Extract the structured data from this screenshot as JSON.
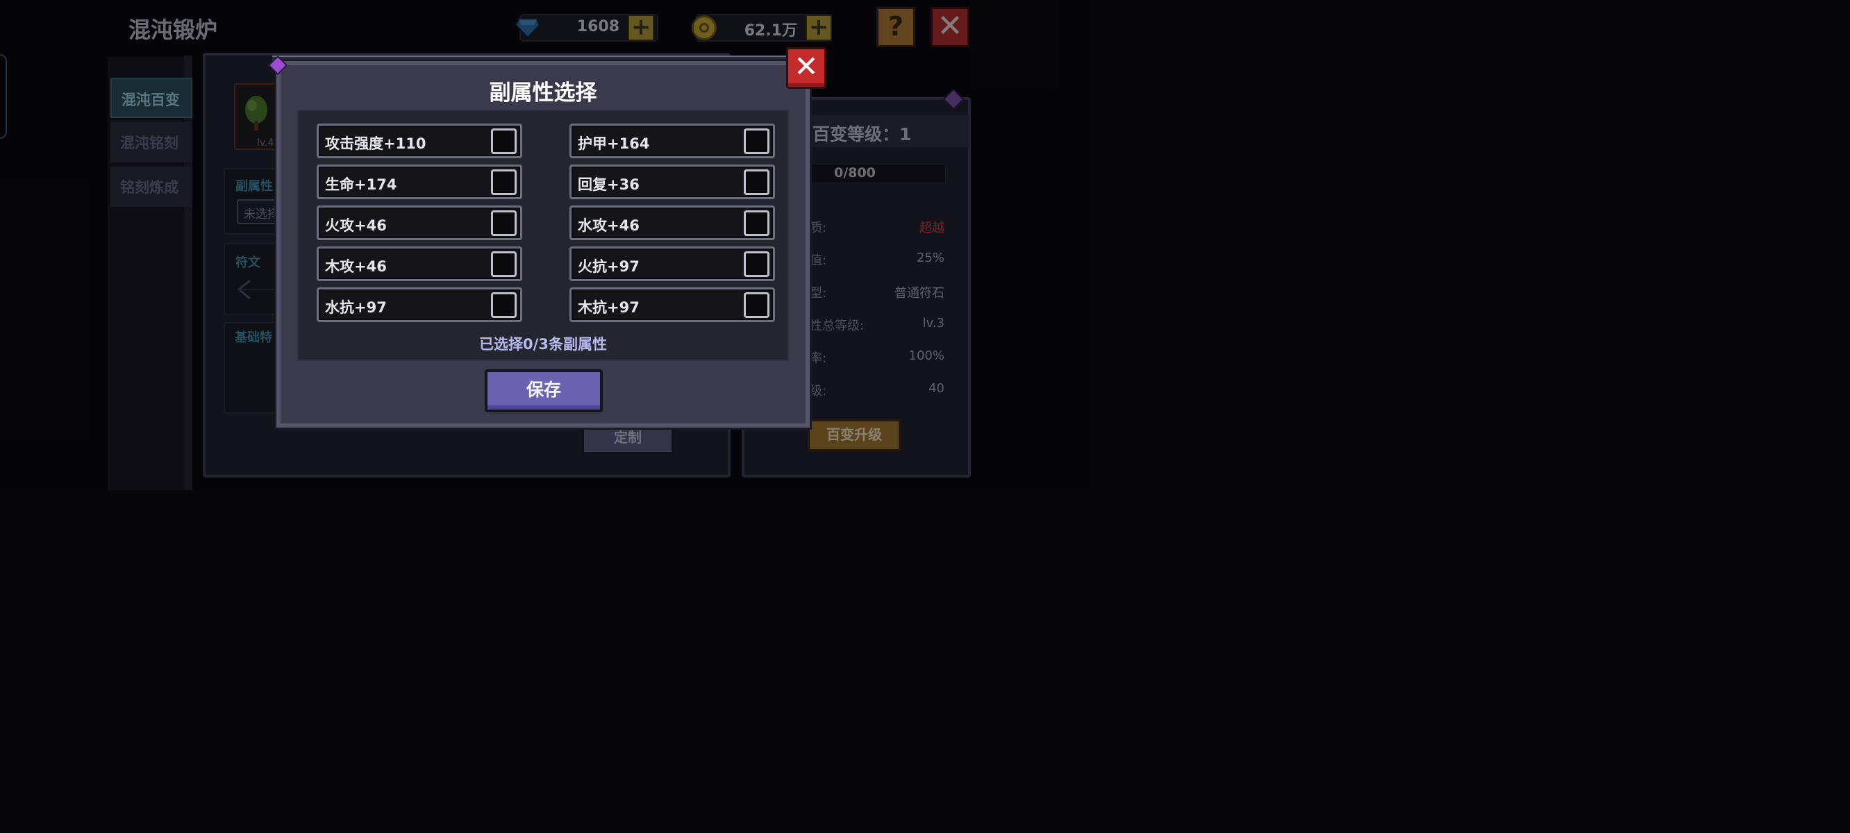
{
  "header": {
    "title": "混沌锻炉",
    "gems": "1608",
    "gold": "62.1万",
    "plus": "+",
    "help": "?",
    "close": "✕"
  },
  "tabs": [
    {
      "label": "混沌百变",
      "active": true
    },
    {
      "label": "混沌铭刻",
      "active": false
    },
    {
      "label": "铭刻炼成",
      "active": false
    }
  ],
  "background": {
    "item_level": "lv.4",
    "sub_attr_label": "副属性",
    "unselected": "未选择",
    "rune_label": "符文",
    "base_label": "基础特",
    "custom_button": "定制",
    "level_title": "百变等级：1",
    "exp": "0/800",
    "stats": [
      {
        "label": "质:",
        "value": "超越"
      },
      {
        "label": "值:",
        "value": "25%"
      },
      {
        "label": "型:",
        "value": "普通符石"
      },
      {
        "label": "性总等级:",
        "value": "lv.3"
      },
      {
        "label": "率:",
        "value": "100%"
      },
      {
        "label": "级:",
        "value": "40"
      }
    ],
    "upgrade_button": "百变升级"
  },
  "modal": {
    "title": "副属性选择",
    "close": "✕",
    "options": [
      {
        "label": "攻击强度+110",
        "checked": false
      },
      {
        "label": "护甲+164",
        "checked": false
      },
      {
        "label": "生命+174",
        "checked": false
      },
      {
        "label": "回复+36",
        "checked": false
      },
      {
        "label": "火攻+46",
        "checked": false
      },
      {
        "label": "水攻+46",
        "checked": false
      },
      {
        "label": "木攻+46",
        "checked": false
      },
      {
        "label": "火抗+97",
        "checked": false
      },
      {
        "label": "水抗+97",
        "checked": false
      },
      {
        "label": "木抗+97",
        "checked": false
      }
    ],
    "selected_count_text": "已选择0/3条副属性",
    "save_button": "保存"
  },
  "colors": {
    "accent_purple": "#6a62b0",
    "close_red": "#c42b2b",
    "quality_red": "#d43c3c",
    "tab_active": "#2a4d59"
  }
}
